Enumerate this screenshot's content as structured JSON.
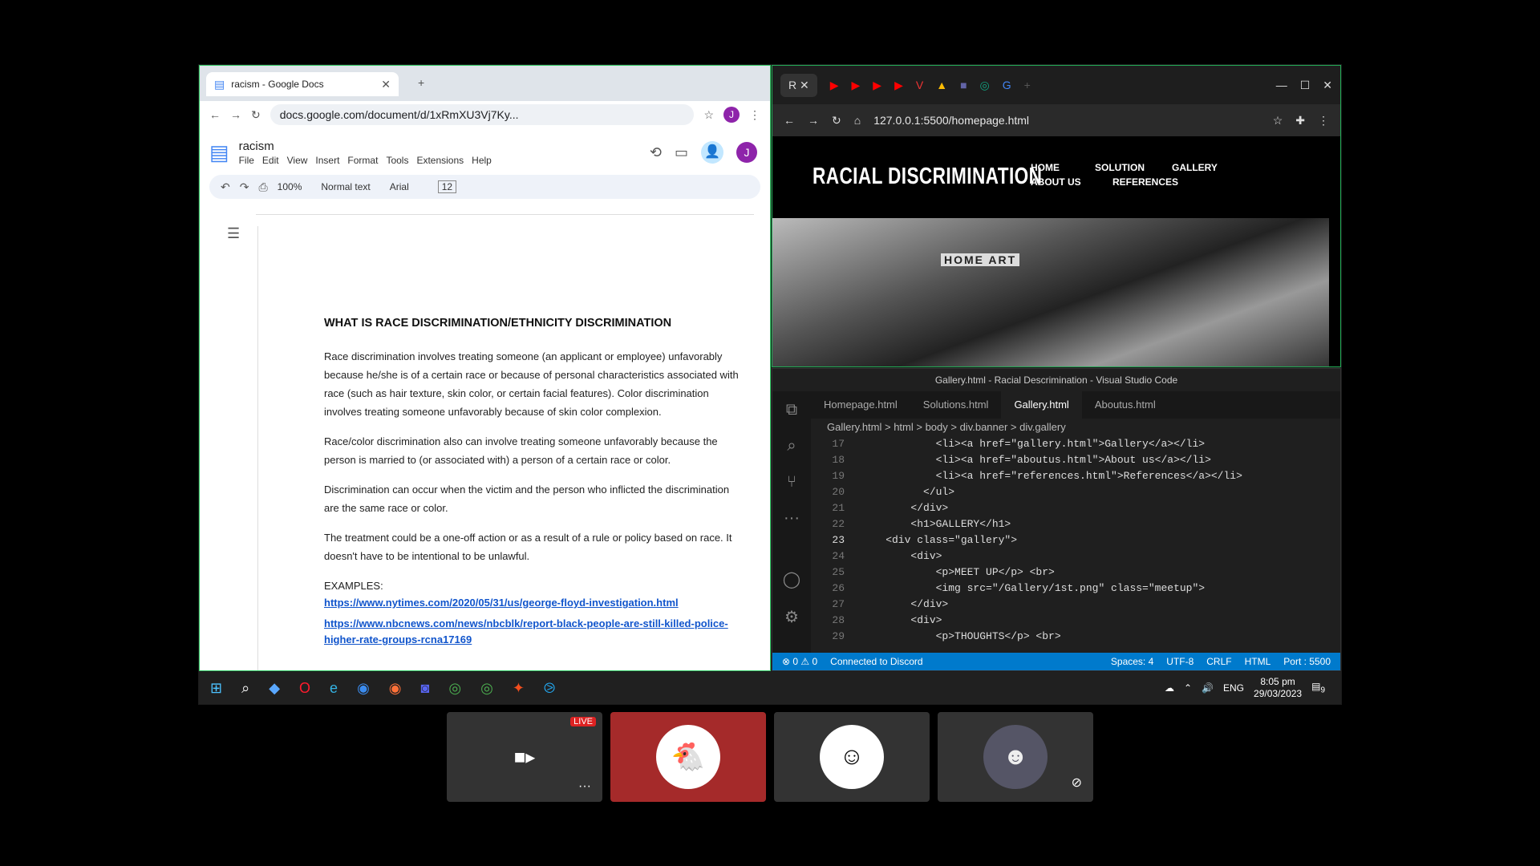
{
  "docs": {
    "tab_title": "racism - Google Docs",
    "url": "docs.google.com/document/d/1xRmXU3Vj7Ky...",
    "doc_name": "racism",
    "menu": [
      "File",
      "Edit",
      "View",
      "Insert",
      "Format",
      "Tools",
      "Extensions",
      "Help"
    ],
    "zoom": "100%",
    "style": "Normal text",
    "font": "Arial",
    "font_size": "12",
    "avatar_letter": "J",
    "heading": "WHAT IS RACE DISCRIMINATION/ETHNICITY DISCRIMINATION",
    "paragraphs": [
      "Race discrimination involves treating someone (an applicant or employee) unfavorably because he/she is of a certain race or because of personal characteristics associated with race (such as hair texture, skin color, or certain facial features). Color discrimination involves treating someone unfavorably because of skin color complexion.",
      "Race/color discrimination also can involve treating someone unfavorably because the person is married to (or associated with) a person of a certain race or color.",
      "Discrimination can occur when the victim and the person who inflicted the discrimination are the same race or color.",
      "The treatment could be a one-off action or as a result of a rule or policy based on race. It doesn't have to be intentional to be unlawful."
    ],
    "examples_label": "EXAMPLES:",
    "links": [
      "https://www.nytimes.com/2020/05/31/us/george-floyd-investigation.html",
      "https://www.nbcnews.com/news/nbcblk/report-black-people-are-still-killed-police-higher-rate-groups-rcna17169"
    ]
  },
  "site": {
    "url": "127.0.0.1:5500/homepage.html",
    "logo": "RACIAL DISCRIMINATION",
    "nav": [
      "HOME",
      "SOLUTION",
      "GALLERY",
      "ABOUT US",
      "REFERENCES"
    ],
    "hero_sign": "HOME ART"
  },
  "vscode": {
    "title": "Gallery.html - Racial Descrimination - Visual Studio Code",
    "tabs": [
      "Homepage.html",
      "Solutions.html",
      "Gallery.html",
      "Aboutus.html"
    ],
    "breadcrumb": "Gallery.html  >  html  >  body  >  div.banner  >  div.gallery",
    "lines": [
      {
        "n": "17",
        "t": "            <li><a href=\"gallery.html\">Gallery</a></li>"
      },
      {
        "n": "18",
        "t": "            <li><a href=\"aboutus.html\">About us</a></li>"
      },
      {
        "n": "19",
        "t": "            <li><a href=\"references.html\">References</a></li>"
      },
      {
        "n": "20",
        "t": "          </ul>"
      },
      {
        "n": "21",
        "t": "        </div>"
      },
      {
        "n": "22",
        "t": "        <h1>GALLERY</h1>"
      },
      {
        "n": "23",
        "t": "    <div class=\"gallery\">"
      },
      {
        "n": "24",
        "t": "        <div>"
      },
      {
        "n": "25",
        "t": "            <p>MEET UP</p> <br>"
      },
      {
        "n": "26",
        "t": "            <img src=\"/Gallery/1st.png\" class=\"meetup\">"
      },
      {
        "n": "27",
        "t": "        </div>"
      },
      {
        "n": "28",
        "t": "        <div>"
      },
      {
        "n": "29",
        "t": "            <p>THOUGHTS</p> <br>"
      }
    ],
    "status": {
      "problems": "⊗ 0 ⚠ 0",
      "discord": "Connected to Discord",
      "spaces": "Spaces: 4",
      "encoding": "UTF-8",
      "eol": "CRLF",
      "lang": "HTML",
      "port": "Port : 5500"
    }
  },
  "taskbar": {
    "lang": "ENG",
    "time": "8:05 pm",
    "date": "29/03/2023",
    "notif": "9"
  },
  "call": {
    "live_badge": "LIVE"
  }
}
